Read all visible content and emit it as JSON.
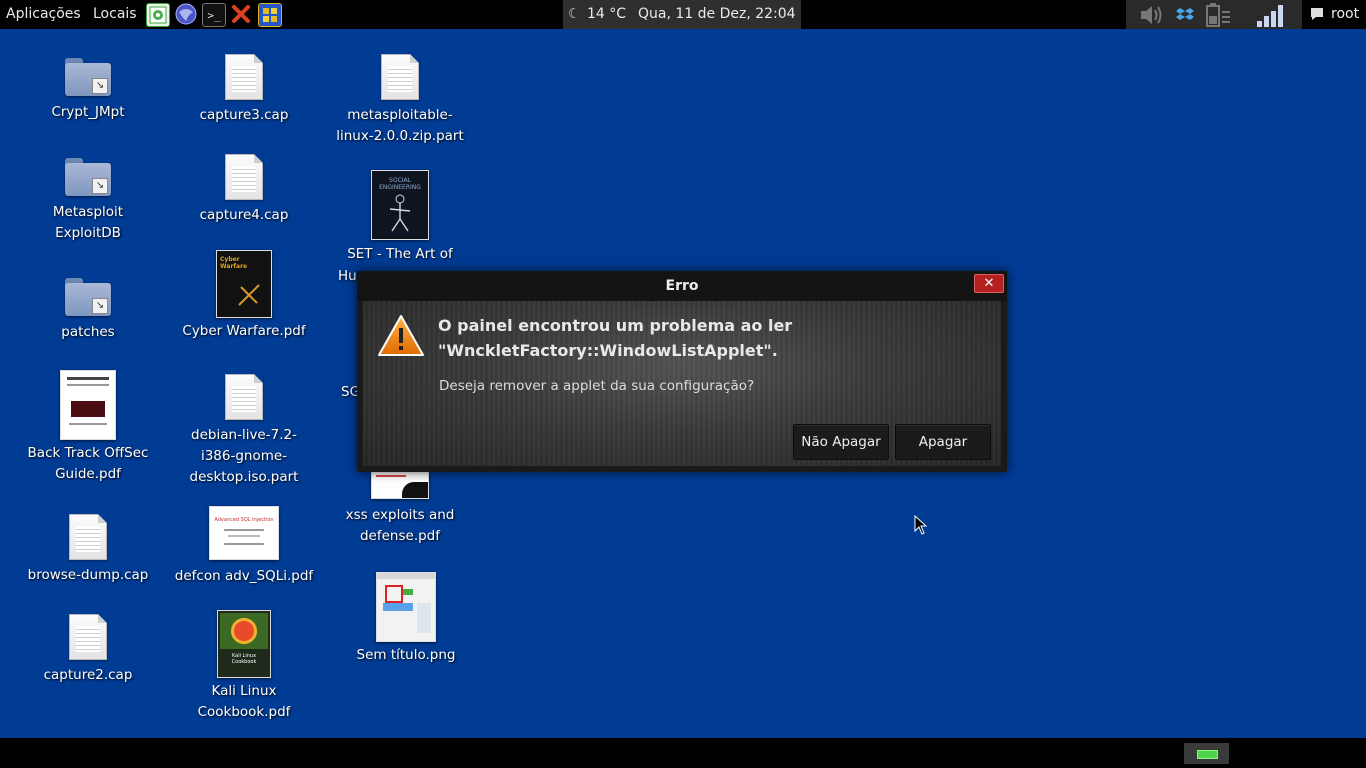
{
  "top_panel": {
    "applications_label": "Aplicações",
    "places_label": "Locais",
    "launchers": [
      {
        "name": "image-viewer-icon",
        "color": "#3da33a"
      },
      {
        "name": "browser-globe-icon",
        "color": "#4a56c8"
      },
      {
        "name": "terminal-icon",
        "color": "#222222"
      },
      {
        "name": "close-x-icon",
        "color": "#e04020"
      },
      {
        "name": "puzzle-icon",
        "color": "#e0b820"
      }
    ],
    "weather": "14 °C",
    "datetime": "Qua, 11 de Dez, 22:04",
    "user": "root"
  },
  "desktop": {
    "col1": [
      {
        "type": "folder",
        "label": "Crypt_JMpt"
      },
      {
        "type": "folder",
        "label": "Metasploit ExploitDB"
      },
      {
        "type": "folder",
        "label": "patches"
      },
      {
        "type": "pdf",
        "label": "Back Track OffSec Guide.pdf"
      },
      {
        "type": "doc",
        "label": "browse-dump.cap"
      },
      {
        "type": "doc",
        "label": "capture2.cap"
      }
    ],
    "col2": [
      {
        "type": "doc",
        "label": "capture3.cap"
      },
      {
        "type": "doc",
        "label": "capture4.cap"
      },
      {
        "type": "pdf",
        "label": "Cyber Warfare.pdf",
        "thumb_text": "Cyber Warfare"
      },
      {
        "type": "doc",
        "label": "debian-live-7.2-i386-gnome-desktop.iso.part"
      },
      {
        "type": "pdf",
        "label": "defcon adv_SQLi.pdf",
        "thumb_text": "Advanced SQL Injection"
      },
      {
        "type": "pdf",
        "label": "Kali Linux Cookbook.pdf",
        "thumb_text": "Kali Linux Cookbook"
      }
    ],
    "col3": [
      {
        "type": "doc",
        "label": "metasploitable-linux-2.0.0.zip.part"
      },
      {
        "type": "pdf",
        "label": "SET - The Art of Hu... Hacking.pdf",
        "label_visible": "SET - The Art of",
        "label_partial": "Hu",
        "thumb_text": "SOCIAL ENGINEERING"
      },
      {
        "type": "pdf",
        "label": "SG",
        "label_visible": "SG"
      },
      {
        "type": "pdf",
        "label": "xss exploits and defense.pdf"
      },
      {
        "type": "png",
        "label": "Sem título.png"
      }
    ]
  },
  "dialog": {
    "title": "Erro",
    "close_symbol": "✕",
    "primary_line1": "O painel encontrou um problema ao ler",
    "primary_line2": "\"WnckletFactory::WindowListApplet\".",
    "secondary": "Deseja remover a applet da sua configuração?",
    "buttons": {
      "dont_delete": "Não Apagar",
      "delete": "Apagar"
    }
  },
  "colors": {
    "desktop_bg": "#003b94",
    "panel_bg": "#000000",
    "dialog_close": "#b52121",
    "workspace_active": "#4ed34a"
  }
}
